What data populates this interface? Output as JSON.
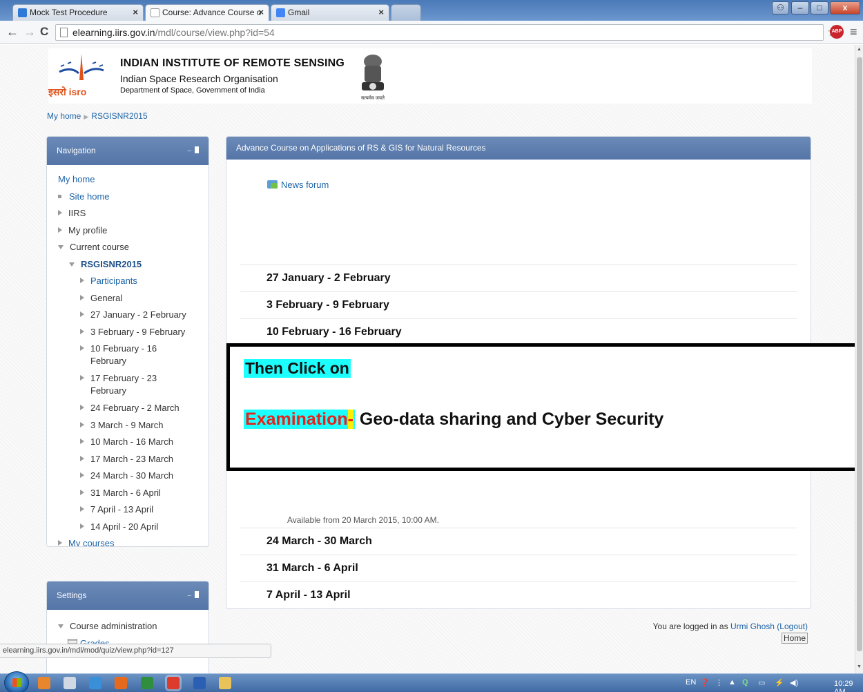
{
  "browser": {
    "tabs": [
      {
        "title": "Mock Test Procedure",
        "active": false,
        "favicon_color": "#2f7ad8"
      },
      {
        "title": "Course: Advance Course o",
        "active": true,
        "favicon_color": "#ffffff"
      },
      {
        "title": "Gmail",
        "active": false,
        "favicon_color": "#4285f4"
      }
    ],
    "url_host": "elearning.iirs.gov.in",
    "url_path": "/mdl/course/view.php?id=54",
    "abp_badge": "ABP"
  },
  "header": {
    "isro_text": "इसरो isro",
    "institute": "INDIAN INSTITUTE OF REMOTE SENSING",
    "org": "Indian Space Research Organisation",
    "dept": "Department of Space, Government of India",
    "emblem_motto": "सत्यमेव जयते"
  },
  "breadcrumb": {
    "home": "My home",
    "course": "RSGISNR2015"
  },
  "navigation": {
    "title": "Navigation",
    "items": [
      {
        "label": "My home",
        "icon": "none",
        "indent": 0,
        "link": true
      },
      {
        "label": "Site home",
        "icon": "square",
        "indent": 0,
        "link": true
      },
      {
        "label": "IIRS",
        "icon": "right",
        "indent": 0,
        "link": false
      },
      {
        "label": "My profile",
        "icon": "right",
        "indent": 0,
        "link": false
      },
      {
        "label": "Current course",
        "icon": "down",
        "indent": 0,
        "link": false
      },
      {
        "label": "RSGISNR2015",
        "icon": "down",
        "indent": 1,
        "link": true,
        "bold": true
      },
      {
        "label": "Participants",
        "icon": "right",
        "indent": 2,
        "link": true
      },
      {
        "label": "General",
        "icon": "right",
        "indent": 2,
        "link": false
      },
      {
        "label": "27 January - 2 February",
        "icon": "right",
        "indent": 2,
        "link": false
      },
      {
        "label": "3 February - 9 February",
        "icon": "right",
        "indent": 2,
        "link": false
      },
      {
        "label": "10 February - 16 February",
        "icon": "right",
        "indent": 2,
        "link": false,
        "wrap": true
      },
      {
        "label": "17 February - 23 February",
        "icon": "right",
        "indent": 2,
        "link": false,
        "wrap": true
      },
      {
        "label": "24 February - 2 March",
        "icon": "right",
        "indent": 2,
        "link": false
      },
      {
        "label": "3 March - 9 March",
        "icon": "right",
        "indent": 2,
        "link": false
      },
      {
        "label": "10 March - 16 March",
        "icon": "right",
        "indent": 2,
        "link": false
      },
      {
        "label": "17 March - 23 March",
        "icon": "right",
        "indent": 2,
        "link": false
      },
      {
        "label": "24 March - 30 March",
        "icon": "right",
        "indent": 2,
        "link": false
      },
      {
        "label": "31 March - 6 April",
        "icon": "right",
        "indent": 2,
        "link": false
      },
      {
        "label": "7 April - 13 April",
        "icon": "right",
        "indent": 2,
        "link": false
      },
      {
        "label": "14 April - 20 April",
        "icon": "right",
        "indent": 2,
        "link": false
      },
      {
        "label": "My courses",
        "icon": "right",
        "indent": 0,
        "link": true
      }
    ]
  },
  "settings": {
    "title": "Settings",
    "course_admin": "Course administration",
    "grades": "Grades"
  },
  "course": {
    "title": "Advance Course on Applications of RS & GIS for Natural Resources",
    "news_forum": "News forum",
    "weeks_top": [
      "27 January - 2 February",
      "3 February - 9 February",
      "10 February - 16 February",
      "17 February - 23 February",
      "24 February - 2 March"
    ],
    "available_note": "Available from 20 March 2015, 10:00 AM.",
    "weeks_bottom": [
      "24 March - 30 March",
      "31 March - 6 April",
      "7 April - 13 April",
      "14 April - 20 April"
    ]
  },
  "overlay": {
    "line1": "Then Click on",
    "exam_word": "Examination",
    "exam_dash": "-",
    "rest": " Geo-data sharing and Cyber Security"
  },
  "footer": {
    "logged_in_prefix": "You are logged in as ",
    "user": "Urmi Ghosh",
    "logout": "(Logout)",
    "home": "Home"
  },
  "status_url": "elearning.iirs.gov.in/mdl/mod/quiz/view.php?id=127",
  "taskbar": {
    "lang": "EN",
    "time": "10:29 AM",
    "apps": [
      {
        "name": "outlook-icon",
        "color": "#e8862e"
      },
      {
        "name": "notepad-icon",
        "color": "#cfd8e3"
      },
      {
        "name": "ie-icon",
        "color": "#3a8fd9"
      },
      {
        "name": "firefox-icon",
        "color": "#e56a1e"
      },
      {
        "name": "excel-icon",
        "color": "#2f8f3e"
      },
      {
        "name": "chrome-icon",
        "color": "#dd3b2c"
      },
      {
        "name": "word-icon",
        "color": "#2b5fb3"
      },
      {
        "name": "explorer-icon",
        "color": "#e9c35a"
      }
    ]
  }
}
